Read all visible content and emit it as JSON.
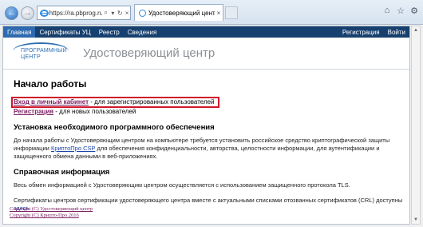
{
  "browser": {
    "address_url": "https://ra.pbprog.ru/UI/",
    "address_search_label": "⌕",
    "address_dropdown_label": "▾",
    "address_refresh_label": "↻",
    "address_close_label": "×",
    "tab_title": "Удостоверяющий центр",
    "tab_close_label": "×"
  },
  "nav": {
    "items": [
      {
        "label": "Главная",
        "active": true
      },
      {
        "label": "Сертификаты УЦ",
        "active": false
      },
      {
        "label": "Реестр",
        "active": false
      },
      {
        "label": "Сведения",
        "active": false
      }
    ],
    "right_items": [
      {
        "label": "Регистрация"
      },
      {
        "label": "Войти"
      }
    ]
  },
  "header": {
    "logo_line1": "ПРОГРАММНЫЙ",
    "logo_line2": "ЦЕНТР",
    "title": "Удостоверяющий центр"
  },
  "main": {
    "heading": "Начало работы",
    "login_link": "Вход в личный кабинет",
    "login_suffix": " - для зарегистрированных пользователей",
    "register_link": "Регистрация",
    "register_suffix": " - для новых пользователей",
    "install_heading": "Установка необходимого программного обеспечения",
    "install_text_before": "До начала работы с Удостоверяющим центром на компьютере требуется установить российское средство криптографической защиты информации",
    "install_link": "КриптоПро CSP",
    "install_text_after": " для обеспечения конфиденциальности, авторства, целостности информации, для аутентификации и защищенного обмена данными в веб-приложениях.",
    "info_heading": "Справочная информация",
    "info_text": "Весь обмен информацией с Удостоверяющим центром осуществляется с использованием защищенного протокола TLS.",
    "cert_text_before": "Сертификаты центров сертификации удостоверяющего центра вместе с актуальными списками отозванных сертификатов (CRL) доступны ",
    "cert_link": "здесь",
    "cert_text_after": "."
  },
  "footer": {
    "line1": "Copyright (C) Удостоверяющий центр",
    "line2": "Copyright (C) Крипто-Про 2016"
  },
  "colors": {
    "navbar": "#16406f",
    "nav_active": "#2d6ab0",
    "highlight_border": "#d0182a",
    "link": "#7a1d60"
  }
}
